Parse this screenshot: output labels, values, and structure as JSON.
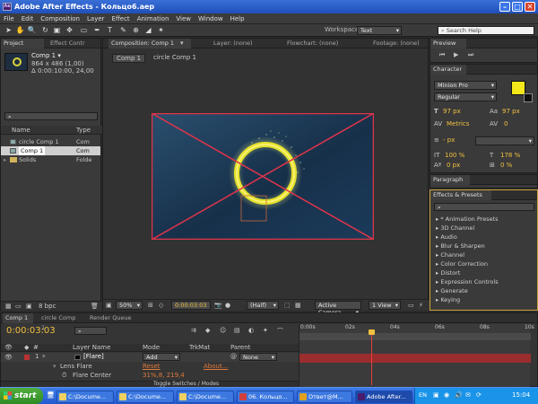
{
  "window": {
    "title": "Adobe After Effects - Кольцо6.aep"
  },
  "menu": [
    "File",
    "Edit",
    "Composition",
    "Layer",
    "Effect",
    "Animation",
    "View",
    "Window",
    "Help"
  ],
  "toolbar": {
    "workspace_label": "Workspace:",
    "workspace_value": "Text",
    "search_placeholder": "Search Help"
  },
  "project": {
    "tab_project": "Project",
    "tab_effect": "Effect Contr",
    "comp_name": "Comp 1 ▾",
    "comp_size": "864 x 486 (1,00)",
    "comp_dur": "Δ 0:00:10:00, 24,00",
    "col_name": "Name",
    "col_type": "Type",
    "items": [
      {
        "name": "circle Comp 1",
        "type": "Com"
      },
      {
        "name": "Comp 1",
        "type": "Com"
      },
      {
        "name": "Solids",
        "type": "Folde"
      }
    ],
    "bpc": "8 bpc"
  },
  "viewer": {
    "tab_comp": "Composition: Comp 1",
    "tab_layer": "Layer: (none)",
    "tab_flow": "Flowchart: (none)",
    "tab_footage": "Footage: (none)",
    "crumb1": "Comp 1",
    "crumb2": "circle Comp 1",
    "zoom": "50%",
    "timecode": "0:00:03:03",
    "resolution": "(Half)",
    "camera": "Active Camera",
    "view": "1 View"
  },
  "preview": {
    "tab": "Preview"
  },
  "character": {
    "tab": "Character",
    "font": "Minion Pro",
    "style": "Regular",
    "size": "97 px",
    "leading": "97 px",
    "kern": "Metrics",
    "tracking": "0",
    "stroke_w": "- px",
    "vscale": "100 %",
    "hscale": "178 %",
    "baseline": "0 px",
    "tsume": "0 %",
    "fill_color": "#f5e81a",
    "stroke_color": "#111111"
  },
  "paragraph": {
    "tab": "Paragraph"
  },
  "effects": {
    "tab": "Effects & Presets",
    "items": [
      "* Animation Presets",
      "3D Channel",
      "Audio",
      "Blur & Sharpen",
      "Channel",
      "Color Correction",
      "Distort",
      "Expression Controls",
      "Generate",
      "Keying"
    ]
  },
  "timeline": {
    "tab_comp": "Comp 1",
    "tab_circle": "circle Comp 1",
    "tab_render": "Render Queue",
    "timecode": "0:00:03:03",
    "col_layer": "Layer Name",
    "col_mode": "Mode",
    "col_trk": "TrkMat",
    "col_parent": "Parent",
    "layer_num": "1",
    "layer_name": "[Flare]",
    "layer_mode": "Add",
    "layer_parent": "None",
    "effect_name": "Lens Flare",
    "reset": "Reset",
    "about": "About...",
    "prop_name": "Flare Center",
    "prop_value": "31%,8, 219,4",
    "toggle_label": "Toggle Switches / Modes",
    "ruler": [
      "0:00s",
      "02s",
      "04s",
      "06s",
      "08s",
      "10s"
    ],
    "playhead_fraction": 0.31
  },
  "taskbar": {
    "start": "start",
    "buttons": [
      "C:\\Docume...",
      "C:\\Docume...",
      "C:\\Docume...",
      "06. Кольцо...",
      "Ответ@M...",
      "Adobe After..."
    ],
    "lang": "EN",
    "clock": "15:04"
  }
}
